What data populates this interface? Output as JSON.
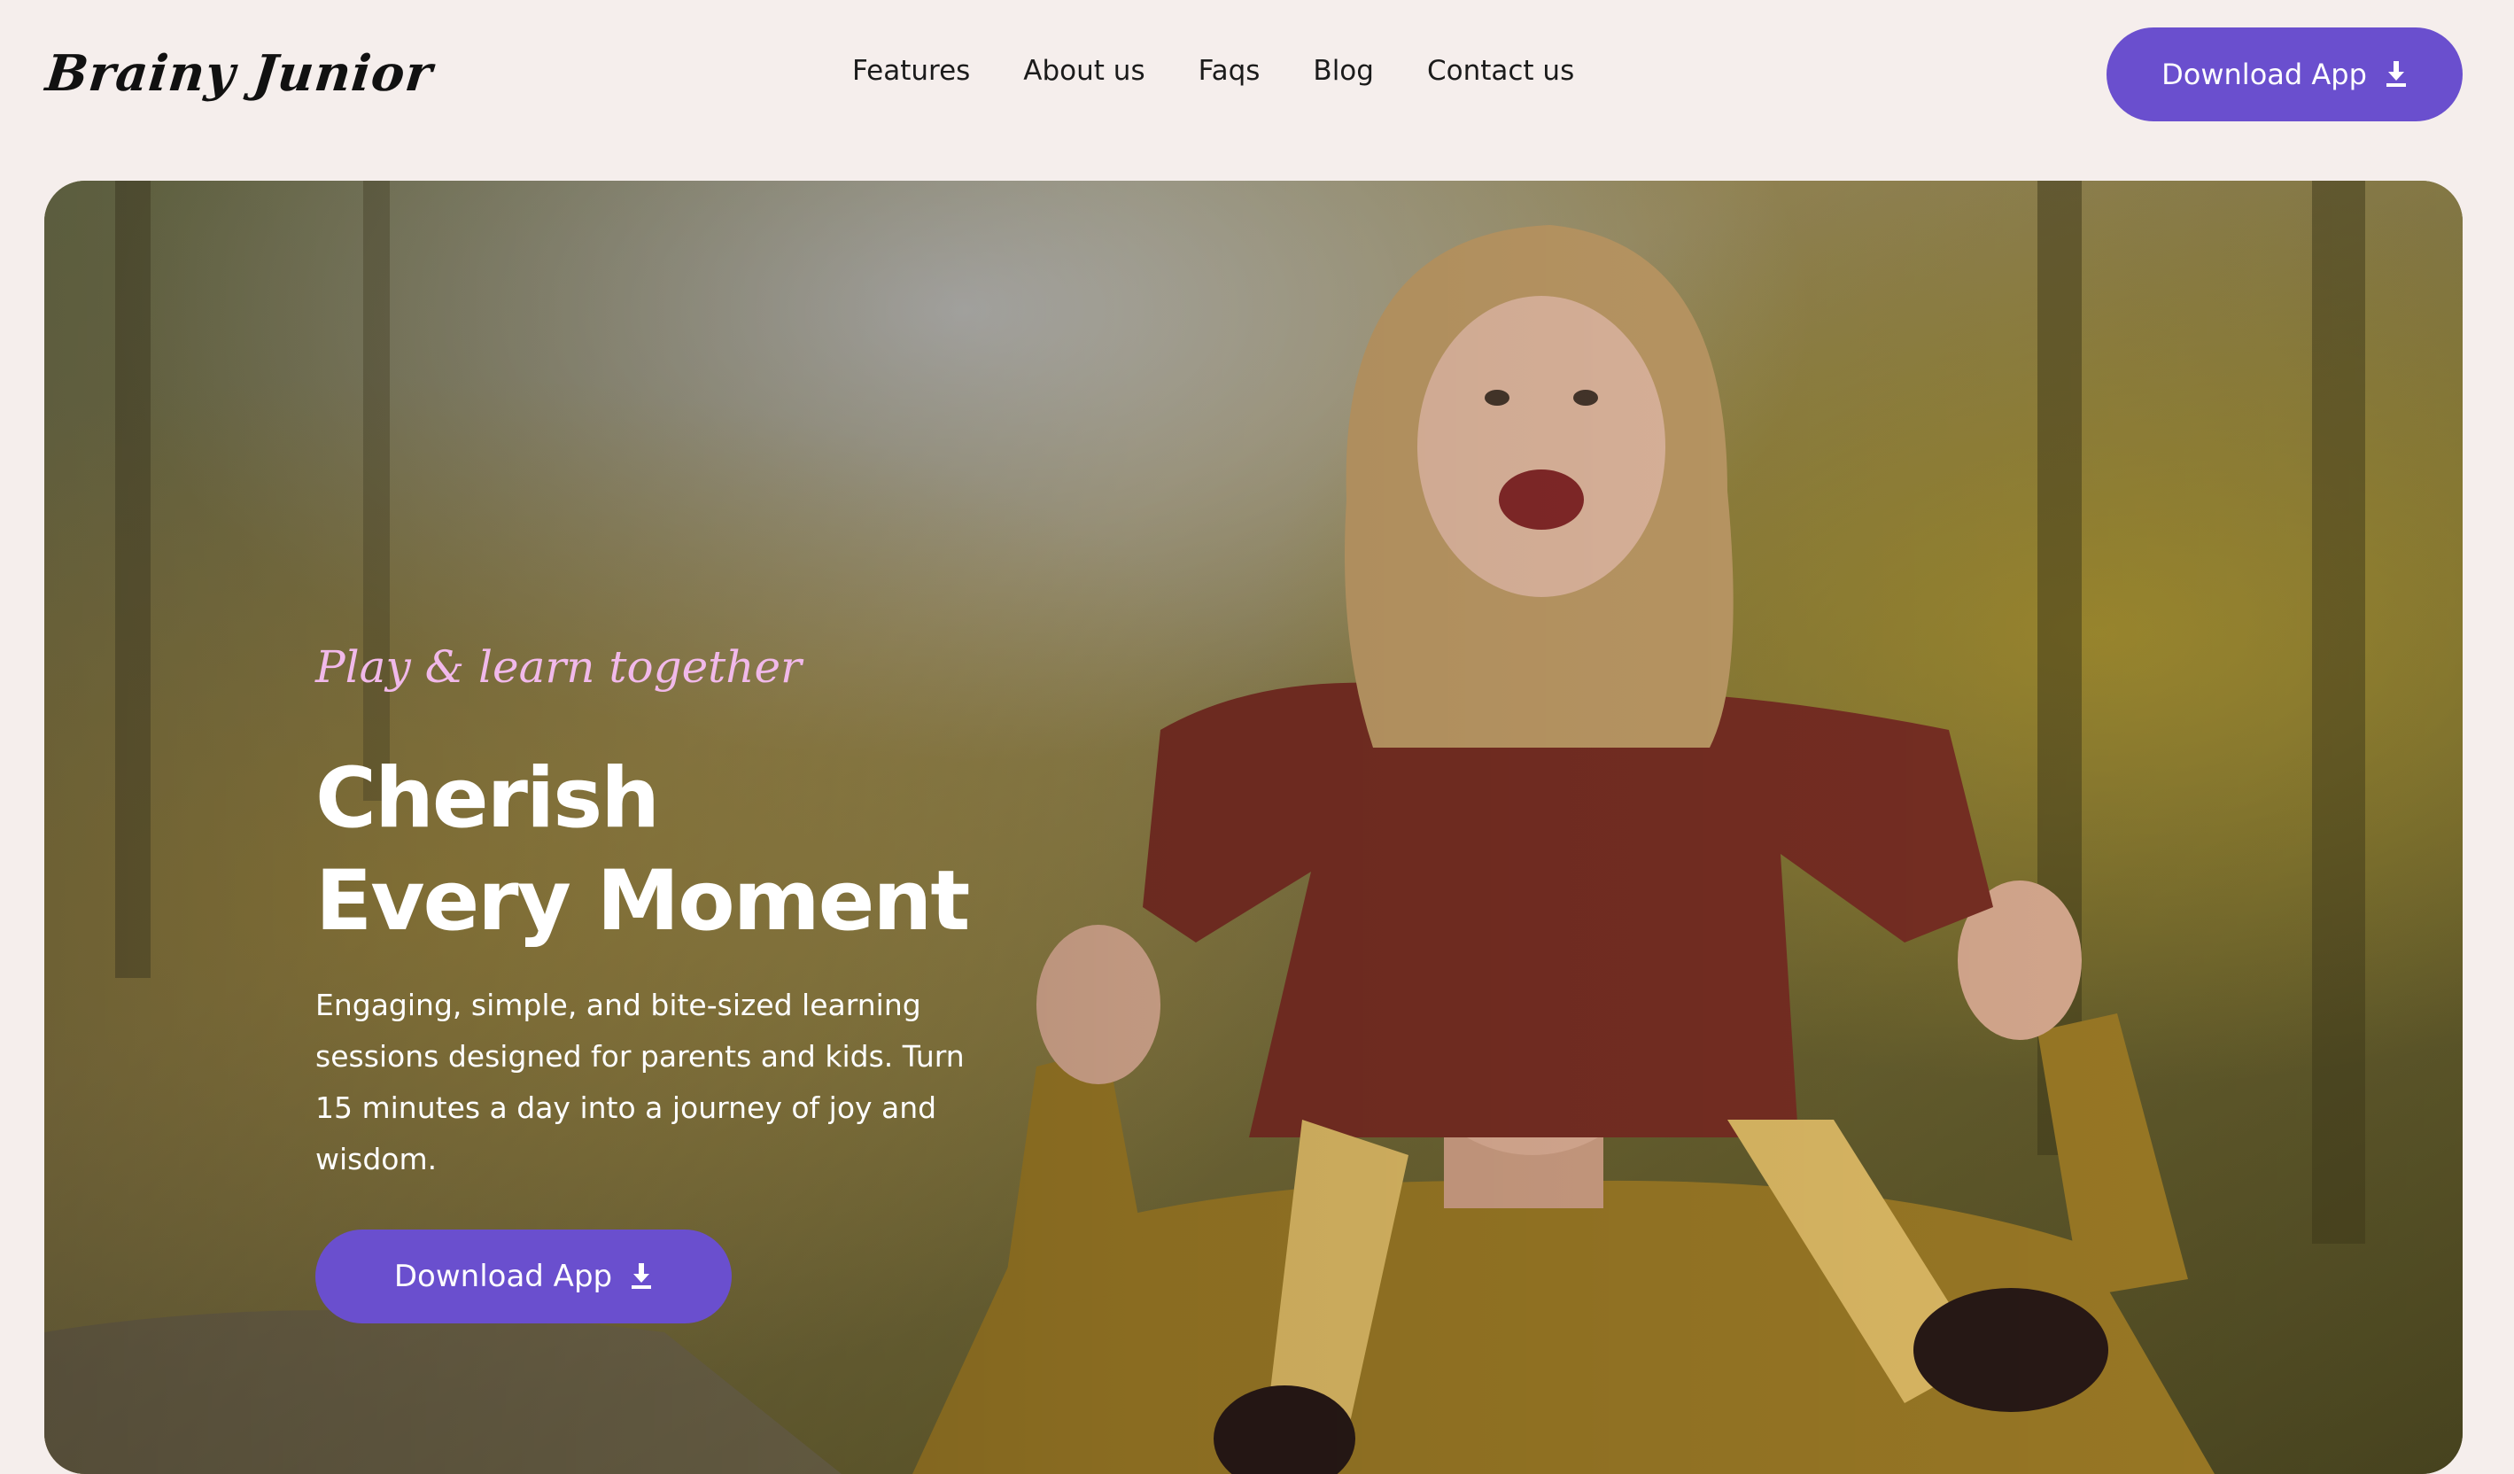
{
  "header": {
    "logo": "Brainy Junior",
    "nav": [
      {
        "label": "Features"
      },
      {
        "label": "About us"
      },
      {
        "label": "Faqs"
      },
      {
        "label": "Blog"
      },
      {
        "label": "Contact us"
      }
    ],
    "cta_label": "Download App",
    "cta_icon": "download-icon"
  },
  "hero": {
    "tagline": "Play & learn together",
    "title_line1": "Cherish",
    "title_line2": "Every Moment",
    "description": "Engaging, simple, and bite-sized learning sessions designed for parents and kids. Turn 15 minutes a day into a journey of joy and wisdom.",
    "cta_label": "Download App",
    "cta_icon": "download-icon"
  },
  "colors": {
    "page_background": "#f5eeec",
    "accent": "#6a4fce",
    "tagline": "#f1b9ea",
    "hero_text": "#ffffff"
  }
}
